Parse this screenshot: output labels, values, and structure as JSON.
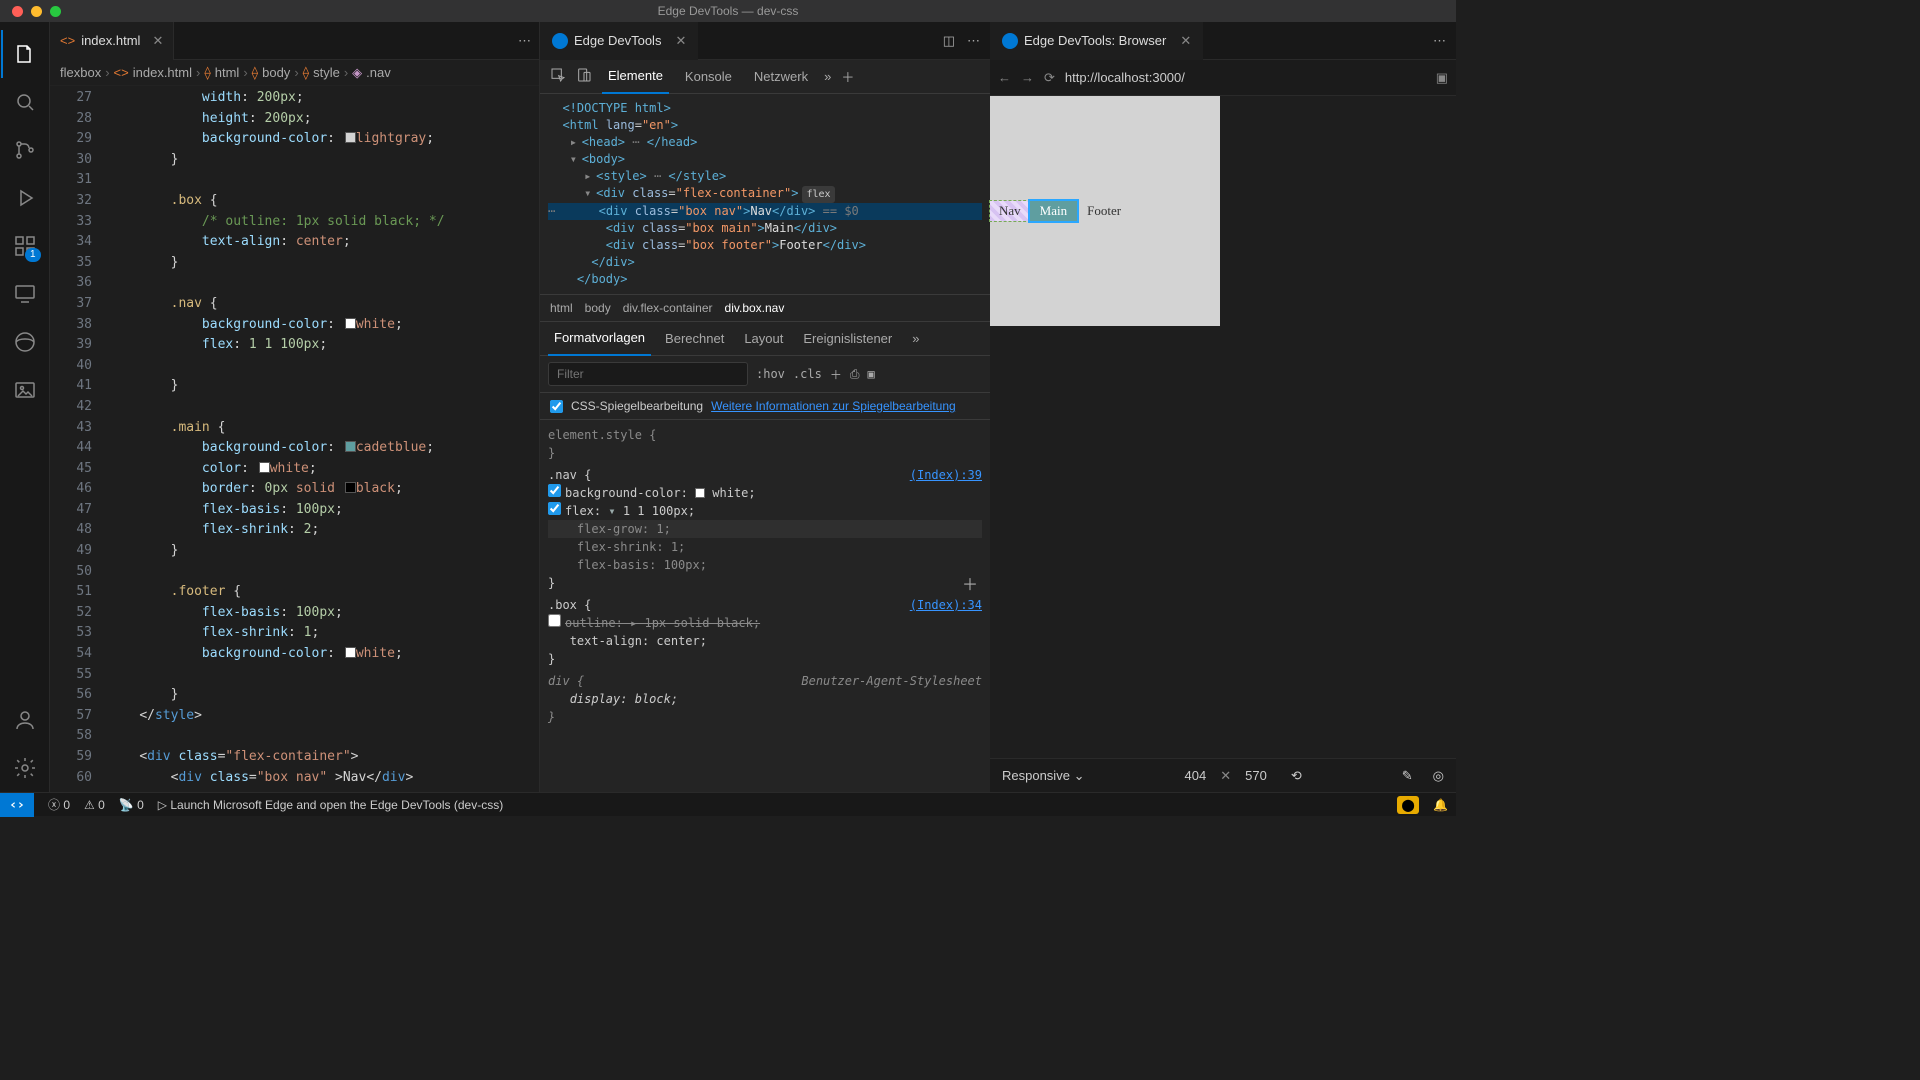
{
  "window": {
    "title": "Edge DevTools — dev-css"
  },
  "editor": {
    "tab": {
      "file": "index.html",
      "closeable": true
    },
    "breadcrumb": [
      "flexbox",
      "index.html",
      "html",
      "body",
      "style",
      ".nav"
    ],
    "lines": [
      {
        "n": 27,
        "html": "            <span class='tok-prop'>width</span><span class='tok-pun'>:</span> <span class='tok-num'>200px</span><span class='tok-pun'>;</span>"
      },
      {
        "n": 28,
        "html": "            <span class='tok-prop'>height</span><span class='tok-pun'>:</span> <span class='tok-num'>200px</span><span class='tok-pun'>;</span>"
      },
      {
        "n": 29,
        "html": "            <span class='tok-prop'>background-color</span><span class='tok-pun'>:</span> <span class='swatch' style='background:#d3d3d3'></span><span class='tok-col'>lightgray</span><span class='tok-pun'>;</span>"
      },
      {
        "n": 30,
        "html": "        <span class='tok-pun'>}</span>"
      },
      {
        "n": 31,
        "html": ""
      },
      {
        "n": 32,
        "html": "        <span class='tok-sel'>.box</span> <span class='tok-pun'>{</span>"
      },
      {
        "n": 33,
        "html": "            <span class='tok-cm'>/* outline: 1px solid black; */</span>"
      },
      {
        "n": 34,
        "html": "            <span class='tok-prop'>text-align</span><span class='tok-pun'>:</span> <span class='tok-val'>center</span><span class='tok-pun'>;</span>"
      },
      {
        "n": 35,
        "html": "        <span class='tok-pun'>}</span>"
      },
      {
        "n": 36,
        "html": ""
      },
      {
        "n": 37,
        "html": "        <span class='tok-sel'>.nav</span> <span class='tok-pun'>{</span>"
      },
      {
        "n": 38,
        "html": "            <span class='tok-prop'>background-color</span><span class='tok-pun'>:</span> <span class='swatch' style='background:#fff'></span><span class='tok-col'>white</span><span class='tok-pun'>;</span>"
      },
      {
        "n": 39,
        "html": "            <span class='tok-prop'>flex</span><span class='tok-pun'>:</span> <span class='tok-num'>1 1 100px</span><span class='tok-pun'>;</span>"
      },
      {
        "n": 40,
        "html": ""
      },
      {
        "n": 41,
        "html": "        <span class='tok-pun'>}</span>"
      },
      {
        "n": 42,
        "html": ""
      },
      {
        "n": 43,
        "html": "        <span class='tok-sel'>.main</span> <span class='tok-pun'>{</span>"
      },
      {
        "n": 44,
        "html": "            <span class='tok-prop'>background-color</span><span class='tok-pun'>:</span> <span class='swatch' style='background:#5f9ea0'></span><span class='tok-col'>cadetblue</span><span class='tok-pun'>;</span>"
      },
      {
        "n": 45,
        "html": "            <span class='tok-prop'>color</span><span class='tok-pun'>:</span> <span class='swatch' style='background:#fff'></span><span class='tok-col'>white</span><span class='tok-pun'>;</span>"
      },
      {
        "n": 46,
        "html": "            <span class='tok-prop'>border</span><span class='tok-pun'>:</span> <span class='tok-num'>0px</span> <span class='tok-val'>solid</span> <span class='swatch' style='background:#000'></span><span class='tok-col'>black</span><span class='tok-pun'>;</span>"
      },
      {
        "n": 47,
        "html": "            <span class='tok-prop'>flex-basis</span><span class='tok-pun'>:</span> <span class='tok-num'>100px</span><span class='tok-pun'>;</span>"
      },
      {
        "n": 48,
        "html": "            <span class='tok-prop'>flex-shrink</span><span class='tok-pun'>:</span> <span class='tok-num'>2</span><span class='tok-pun'>;</span>"
      },
      {
        "n": 49,
        "html": "        <span class='tok-pun'>}</span>"
      },
      {
        "n": 50,
        "html": ""
      },
      {
        "n": 51,
        "html": "        <span class='tok-sel'>.footer</span> <span class='tok-pun'>{</span>"
      },
      {
        "n": 52,
        "html": "            <span class='tok-prop'>flex-basis</span><span class='tok-pun'>:</span> <span class='tok-num'>100px</span><span class='tok-pun'>;</span>"
      },
      {
        "n": 53,
        "html": "            <span class='tok-prop'>flex-shrink</span><span class='tok-pun'>:</span> <span class='tok-num'>1</span><span class='tok-pun'>;</span>"
      },
      {
        "n": 54,
        "html": "            <span class='tok-prop'>background-color</span><span class='tok-pun'>:</span> <span class='swatch' style='background:#fff'></span><span class='tok-col'>white</span><span class='tok-pun'>;</span>"
      },
      {
        "n": 55,
        "html": ""
      },
      {
        "n": 56,
        "html": "        <span class='tok-pun'>}</span>"
      },
      {
        "n": 57,
        "html": "    <span class='tok-pun'>&lt;/</span><span class='tok-tag'>style</span><span class='tok-pun'>&gt;</span>"
      },
      {
        "n": 58,
        "html": ""
      },
      {
        "n": 59,
        "html": "    <span class='tok-pun'>&lt;</span><span class='tok-tag'>div</span> <span class='tok-attr'>class</span><span class='tok-pun'>=</span><span class='tok-str'>\"flex-container\"</span><span class='tok-pun'>&gt;</span>"
      },
      {
        "n": 60,
        "html": "        <span class='tok-pun'>&lt;</span><span class='tok-tag'>div</span> <span class='tok-attr'>class</span><span class='tok-pun'>=</span><span class='tok-str'>\"box nav\"</span> <span class='tok-pun'>&gt;</span>Nav<span class='tok-pun'>&lt;/</span><span class='tok-tag'>div</span><span class='tok-pun'>&gt;</span>"
      }
    ]
  },
  "devtools": {
    "tabTitle": "Edge DevTools",
    "toolbarTabs": [
      "Elemente",
      "Konsole",
      "Netzwerk"
    ],
    "activeTab": "Elemente",
    "crumbs": [
      "html",
      "body",
      "div.flex-container",
      "div.box.nav"
    ],
    "stylesTabs": [
      "Formatvorlagen",
      "Berechnet",
      "Layout",
      "Ereignislistener"
    ],
    "activeStylesTab": "Formatvorlagen",
    "filterPlaceholder": "Filter",
    "hov": ":hov",
    "cls": ".cls",
    "mirror": {
      "label": "CSS-Spiegelbearbeitung",
      "link": "Weitere Informationen zur Spiegelbearbeitung"
    },
    "rules": {
      "elementStyle": "element.style {",
      "nav": {
        "selector": ".nav {",
        "source": "(Index):39",
        "bg": {
          "prop": "background-color",
          "val": "white",
          "swatch": "#ffffff"
        },
        "flex": {
          "prop": "flex",
          "val": "1 1 100px"
        },
        "grow": "flex-grow: 1;",
        "shrink": "flex-shrink: 1;",
        "basis": "flex-basis: 100px;"
      },
      "box": {
        "selector": ".box {",
        "source": "(Index):34",
        "outline": "outline: ▸ 1px solid    black;",
        "ta": {
          "prop": "text-align",
          "val": "center"
        }
      },
      "div": {
        "selector": "div {",
        "source": "Benutzer-Agent-Stylesheet",
        "display": {
          "prop": "display",
          "val": "block"
        }
      }
    }
  },
  "browser": {
    "tabTitle": "Edge DevTools: Browser",
    "url": "http://localhost:3000/",
    "demo": {
      "nav": "Nav",
      "main": "Main",
      "footer": "Footer"
    },
    "device": {
      "mode": "Responsive",
      "w": "404",
      "h": "570"
    }
  },
  "status": {
    "errors": "0",
    "warnings": "0",
    "ports": "0",
    "launchMsg": "Launch Microsoft Edge and open the Edge DevTools (dev-css)"
  },
  "activity": {
    "badge": "1"
  }
}
